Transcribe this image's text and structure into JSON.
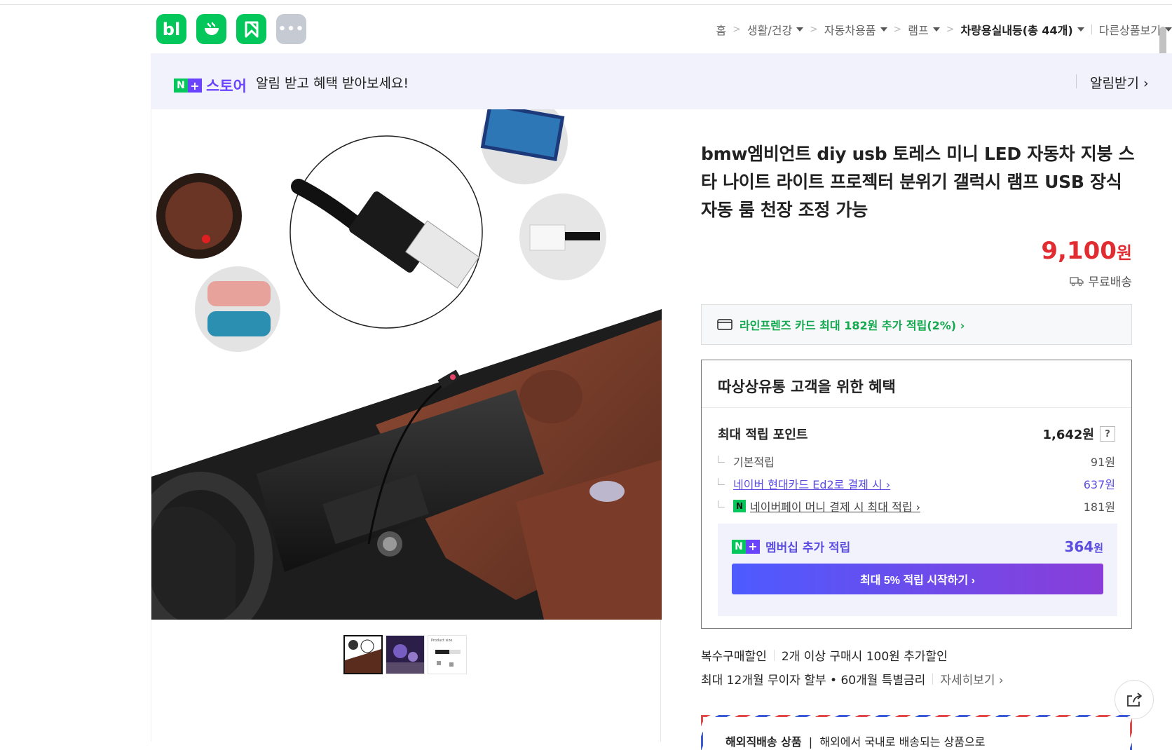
{
  "header": {
    "app_icons": [
      {
        "name": "blog-app-icon",
        "label": "bl"
      },
      {
        "name": "cafe-app-icon",
        "label": ""
      },
      {
        "name": "bookmark-app-icon",
        "label": ""
      },
      {
        "name": "more-apps-icon",
        "label": "•••"
      }
    ],
    "breadcrumb": {
      "home": "홈",
      "items": [
        "생활/건강",
        "자동차용품",
        "램프"
      ],
      "current": "차량용실내등(총 44개)",
      "other": "다른상품보기"
    }
  },
  "notice": {
    "badge_n": "N",
    "badge_plus": "+",
    "store": "스토어",
    "message": "알림 받고 혜택 받아보세요!",
    "action": "알림받기 ›"
  },
  "product": {
    "title": "bmw엠비언트 diy usb 토레스 미니 LED 자동차 지붕 스타 나이트 라이트 프로젝터 분위기 갤럭시 램프 USB 장식 자동 룸 천장 조정 가능",
    "price": "9,100",
    "price_unit": "원",
    "shipping": "무료배송",
    "card_banner": "라인프렌즈 카드 최대 182원 추가 적립(2%) ›",
    "thumb_count": 3
  },
  "benefit": {
    "heading": "따상상유통 고객을 위한 혜택",
    "max_points_label": "최대 적립 포인트",
    "max_points_value": "1,642원",
    "help": "?",
    "rows": [
      {
        "label": "기본적립",
        "value": "91원"
      },
      {
        "label": "네이버 현대카드 Ed2로 결제 시 ›",
        "value": "637원"
      },
      {
        "label": "네이버페이 머니 결제 시 최대 적립 ›",
        "value": "181원"
      }
    ],
    "membership_label": "멤버십 추가 적립",
    "membership_value": "364",
    "membership_unit": "원",
    "start_button": "최대 5% 적립 시작하기 ›"
  },
  "extra": {
    "multi_label": "복수구매할인",
    "multi_text": "2개 이상 구매시 100원 추가할인",
    "install_text": "최대 12개월 무이자 할부 • 60개월 특별금리",
    "install_more": "자세히보기 ›",
    "overseas_label": "해외직배송 상품",
    "overseas_text": "해외에서 국내로 배송되는 상품으로"
  },
  "colors": {
    "brand_green": "#03c75a",
    "brand_purple": "#6a43ff",
    "price_red": "#e12c31",
    "card_green": "#12a84e"
  }
}
